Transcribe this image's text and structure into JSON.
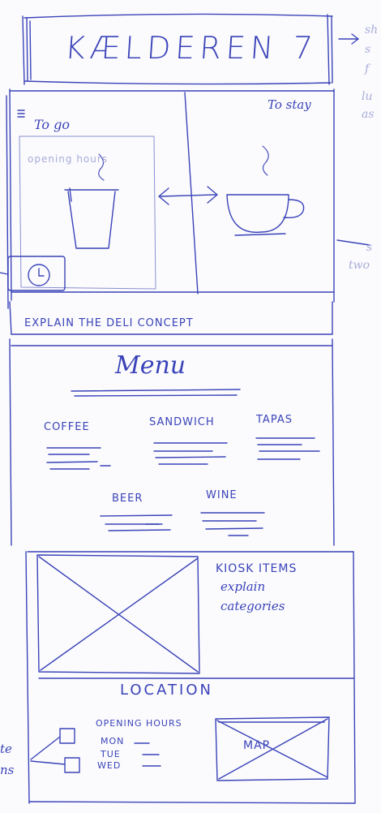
{
  "header": {
    "title": "KÆLDEREN 7"
  },
  "hero": {
    "to_go_label": "To go",
    "to_stay_label": "To stay",
    "faint_label": "opening hours"
  },
  "concept": {
    "text": "EXPLAIN THE DELI CONCEPT"
  },
  "menu": {
    "title": "Menu",
    "categories": [
      "COFFEE",
      "SANDWICH",
      "TAPAS",
      "BEER",
      "WINE"
    ]
  },
  "kiosk": {
    "text_lines": [
      "KIOSK ITEMS",
      "explain",
      "categories"
    ]
  },
  "location": {
    "title": "LOCATION",
    "opening_hours_label": "OPENING HOURS",
    "days": [
      "MON",
      "TUE",
      "WED"
    ],
    "map_label": "MAP"
  },
  "margin_notes": {
    "side_fragment_1": "te",
    "side_fragment_2": "ns",
    "right_fragments": [
      "sh",
      "s",
      "f",
      "lu",
      "as",
      "s",
      "two"
    ]
  },
  "colors": {
    "ink": "#3a43b8",
    "faint_ink": "#a8acd9",
    "paper": "#fbfbfd"
  }
}
